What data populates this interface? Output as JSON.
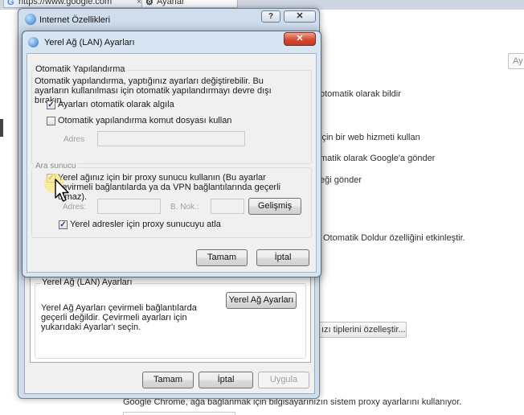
{
  "browser": {
    "tabs": [
      {
        "label": "https://www.google.com",
        "close": "×"
      },
      {
        "label": "Ayarlar"
      }
    ]
  },
  "settings": {
    "search_placeholder": "Ay",
    "lines": [
      "otomatik olarak bildir",
      "için bir web hizmeti kullan",
      "matik olarak Google'a gönder",
      "eği gönder",
      "Otomatik Doldur özelliğini etkinleştir."
    ],
    "content_types_button": "ızı tiplerini özelleştir...",
    "proxy_note": "Google Chrome, ağa bağlanmak için bilgisayarınızın sistem proxy ayarlarını kullanıyor."
  },
  "internet_options": {
    "title": "Internet Özellikleri",
    "help_label": "?",
    "close_label": "✕",
    "lan_group": {
      "legend": "Yerel Ağ (LAN) Ayarları",
      "description": "Yerel Ağ Ayarları çevirmeli bağlantılarda geçerli değildir. Çevirmeli ayarları için yukarıdaki Ayarlar'ı seçin.",
      "button": "Yerel Ağ Ayarları"
    },
    "buttons": {
      "ok": "Tamam",
      "cancel": "İptal",
      "apply": "Uygula"
    }
  },
  "lan_dialog": {
    "title": "Yerel Ağ (LAN) Ayarları",
    "close_label": "✕",
    "auto_config": {
      "legend": "Otomatik Yapılandırma",
      "description": "Otomatik yapılandırma, yaptığınız ayarları değiştirebilir. Bu ayarların kullanılması için otomatik yapılandırmayı devre dışı bırakın.",
      "detect_label": "Ayarları otomatik olarak algıla",
      "detect_checked": true,
      "script_label": "Otomatik yapılandırma komut dosyası kullan",
      "script_checked": false,
      "address_label": "Adres",
      "address_value": ""
    },
    "proxy": {
      "legend": "Ara sunucu",
      "use_proxy_label": "Yerel ağınız için bir proxy sunucu kullanın (Bu ayarlar çevirmeli bağlantılarda ya da VPN bağlantılarında geçerli olmaz).",
      "use_proxy_checked": true,
      "address_label": "Adres:",
      "address_value": "",
      "port_label": "B. Nok.:",
      "port_value": "",
      "advanced_button": "Gelişmiş",
      "bypass_label": "Yerel adresler için proxy sunucuyu atla",
      "bypass_checked": true
    },
    "buttons": {
      "ok": "Tamam",
      "cancel": "İptal"
    }
  }
}
